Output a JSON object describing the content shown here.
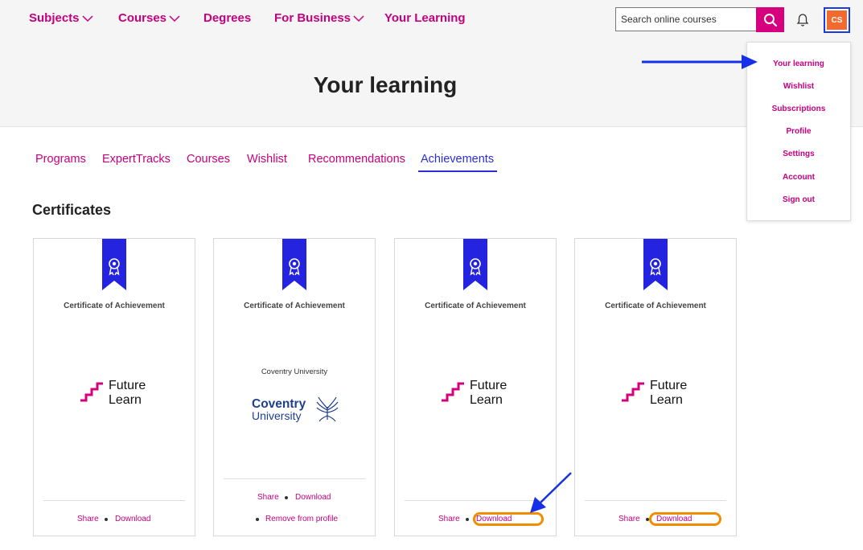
{
  "nav": {
    "subjects": "Subjects",
    "courses": "Courses",
    "degrees": "Degrees",
    "for_business": "For Business",
    "your_learning": "Your Learning"
  },
  "search": {
    "placeholder": "Search online courses"
  },
  "user": {
    "initials": "CS"
  },
  "page": {
    "title": "Your learning"
  },
  "dropdown": {
    "items": [
      "Your learning",
      "Wishlist",
      "Subscriptions",
      "Profile",
      "Settings",
      "Account",
      "Sign out"
    ]
  },
  "tabs": [
    "Programs",
    "ExpertTracks",
    "Courses",
    "Wishlist",
    "Recommendations",
    "Achievements"
  ],
  "active_tab": "Achievements",
  "section": {
    "title": "Certificates"
  },
  "certificates": [
    {
      "title": "Certificate of Achievement",
      "logo": "FutureLearn",
      "logo_line1": "Future",
      "logo_line2": "Learn",
      "share": "Share",
      "download": "Download"
    },
    {
      "title": "Certificate of Achievement",
      "university": "Coventry University",
      "logo": "Coventry University",
      "logo_line1": "Coventry",
      "logo_line2": "University",
      "share": "Share",
      "download": "Download",
      "remove": "Remove from profile"
    },
    {
      "title": "Certificate of Achievement",
      "logo": "FutureLearn",
      "logo_line1": "Future",
      "logo_line2": "Learn",
      "share": "Share",
      "download": "Download"
    },
    {
      "title": "Certificate of Achievement",
      "logo": "FutureLearn",
      "logo_line1": "Future",
      "logo_line2": "Learn",
      "share": "Share",
      "download": "Download"
    }
  ],
  "colors": {
    "brand_pink": "#c4007f",
    "accent_blue": "#2b2ed8",
    "highlight_orange": "#f28c00",
    "avatar_orange": "#f26a2e"
  }
}
